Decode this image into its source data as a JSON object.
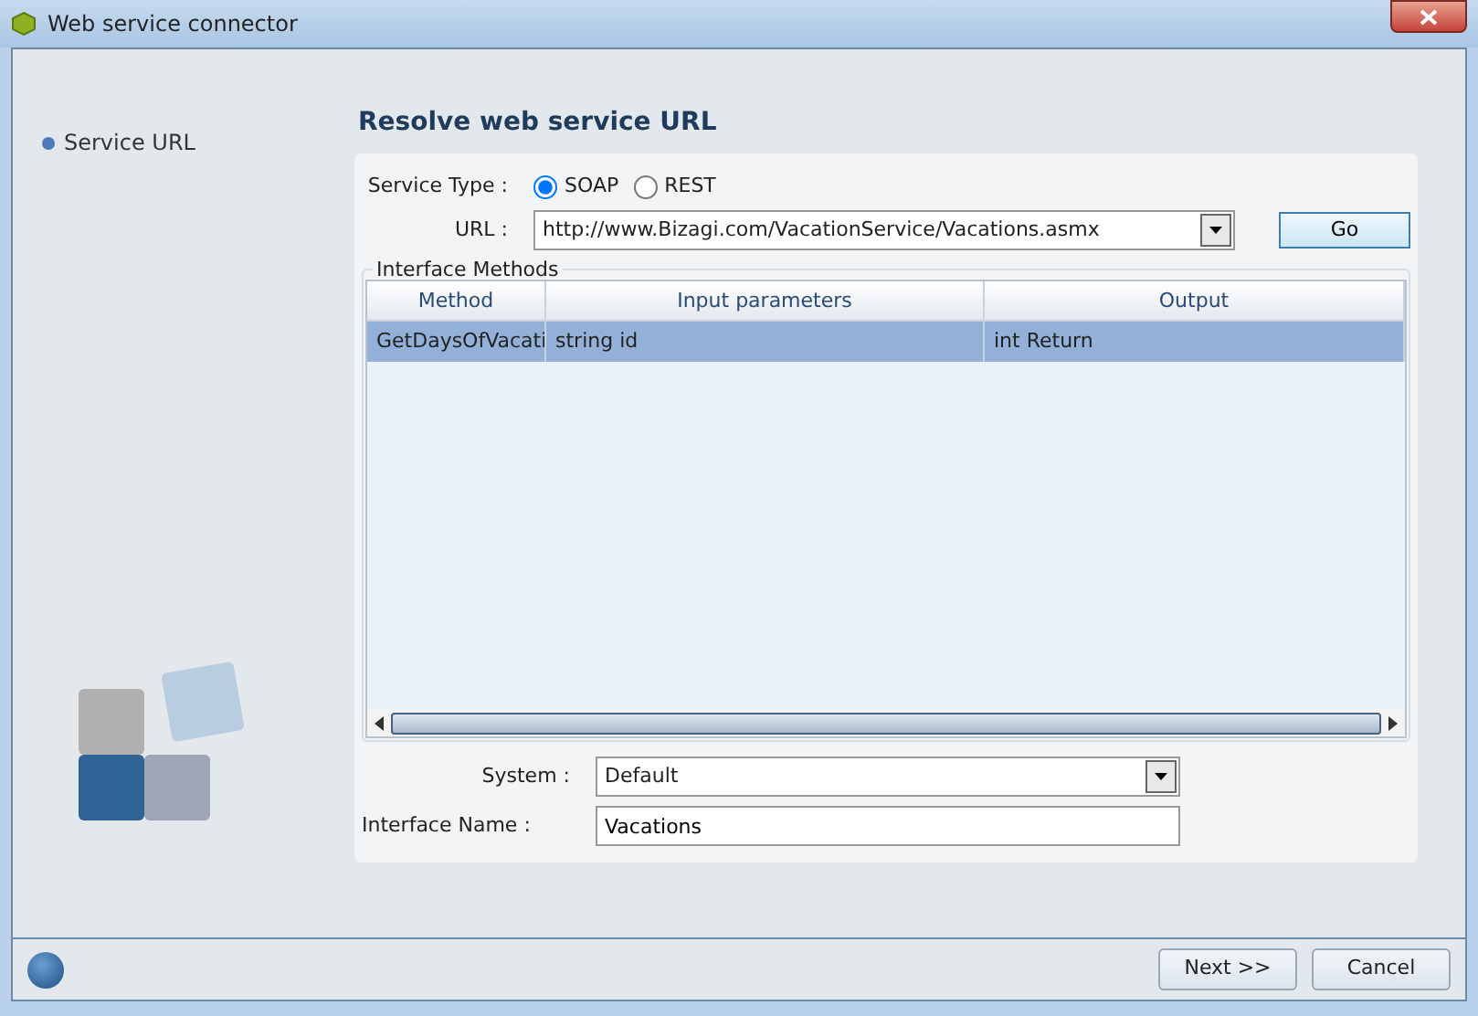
{
  "window": {
    "title": "Web service connector"
  },
  "sidebar": {
    "items": [
      {
        "label": "Service URL",
        "selected": true
      }
    ]
  },
  "heading": "Resolve web service URL",
  "service_type": {
    "label": "Service Type :",
    "options": [
      {
        "label": "SOAP",
        "selected": true
      },
      {
        "label": "REST",
        "selected": false
      }
    ]
  },
  "url": {
    "label": "URL :",
    "value": "http://www.Bizagi.com/VacationService/Vacations.asmx"
  },
  "go_button": "Go",
  "interface_methods": {
    "title": "Interface Methods",
    "columns": [
      "Method",
      "Input parameters",
      "Output"
    ],
    "rows": [
      {
        "cells": [
          "GetDaysOfVacati",
          "string id",
          "int Return"
        ],
        "selected": true
      }
    ]
  },
  "system": {
    "label": "System :",
    "value": "Default"
  },
  "interface_name": {
    "label": "Interface Name :",
    "value": "Vacations"
  },
  "buttons": [
    {
      "label": "Next >>"
    },
    {
      "label": "Cancel"
    }
  ]
}
